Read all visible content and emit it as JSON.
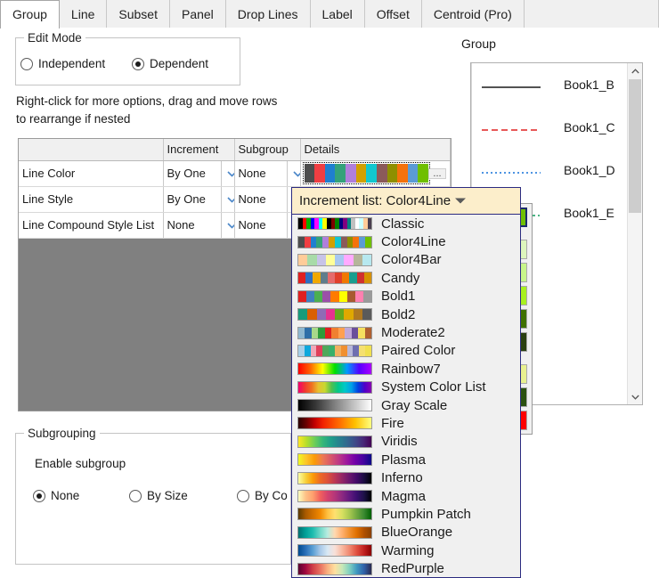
{
  "tabs": [
    {
      "label": "Group",
      "active": true
    },
    {
      "label": "Line",
      "active": false
    },
    {
      "label": "Subset",
      "active": false
    },
    {
      "label": "Panel",
      "active": false
    },
    {
      "label": "Drop Lines",
      "active": false
    },
    {
      "label": "Label",
      "active": false
    },
    {
      "label": "Offset",
      "active": false
    },
    {
      "label": "Centroid (Pro)",
      "active": false
    }
  ],
  "edit_mode": {
    "title": "Edit Mode",
    "options": [
      {
        "label": "Independent",
        "checked": false
      },
      {
        "label": "Dependent",
        "checked": true
      }
    ]
  },
  "hint": "Right-click for more options, drag and move rows to  rearrange if nested",
  "grid": {
    "headers": [
      "",
      "Increment",
      "Subgroup",
      "Details"
    ],
    "rows": [
      {
        "name": "Line Color",
        "increment": "By One",
        "subgroup": "None",
        "details_type": "palette"
      },
      {
        "name": "Line Style",
        "increment": "By One",
        "subgroup": "None",
        "details_type": "empty"
      },
      {
        "name": "Line Compound Style List",
        "increment": "None",
        "subgroup": "None",
        "details_type": "empty"
      }
    ],
    "details_palette": [
      "#4d4d4d",
      "#ef3e42",
      "#1f7fd0",
      "#34a27a",
      "#b07fdb",
      "#d2a000",
      "#12c7cf",
      "#8b5a5a",
      "#8f8f00",
      "#f5720c",
      "#5b9bd5",
      "#6fbf00"
    ],
    "ellipsis_label": "...",
    "empty_area_color": "#808080"
  },
  "group_panel": {
    "label": "Group",
    "items": [
      {
        "label": "Book1_B",
        "color": "#1a1a1a",
        "style": "solid"
      },
      {
        "label": "Book1_C",
        "color": "#e02020",
        "style": "dashed"
      },
      {
        "label": "Book1_D",
        "color": "#1470d8",
        "style": "dotted"
      },
      {
        "label": "Book1_E",
        "color": "#0f9a5a",
        "style": "dashdot"
      }
    ]
  },
  "subgrouping": {
    "title": "Subgrouping",
    "enable_label": "Enable subgroup",
    "options": [
      {
        "label": "None",
        "checked": true
      },
      {
        "label": "By Size",
        "checked": false
      },
      {
        "label": "By Co",
        "checked": false
      }
    ]
  },
  "increment_dropdown": {
    "header_label": "Increment list: Color4Line",
    "selected": "Color4Line",
    "items": [
      {
        "label": "Classic",
        "colors": [
          "#000000",
          "#ff0000",
          "#00b000",
          "#0000ff",
          "#ff00ff",
          "#00ffff",
          "#ffff00",
          "#000000",
          "#800000",
          "#008000",
          "#000080",
          "#800080",
          "#008080",
          "#c0c0c0",
          "#ffffff",
          "#ccffff",
          "#ffcc99",
          "#4a3f50"
        ]
      },
      {
        "label": "Color4Line",
        "colors": [
          "#4d4d4d",
          "#ef3e42",
          "#1f7fd0",
          "#34a27a",
          "#b07fdb",
          "#d2a000",
          "#12c7cf",
          "#8b5a5a",
          "#8f8f00",
          "#f5720c",
          "#5b9bd5",
          "#6fbf00"
        ]
      },
      {
        "label": "Color4Bar",
        "colors": [
          "#ffcc99",
          "#a8dba8",
          "#c7c3e8",
          "#ffff99",
          "#a8c8f0",
          "#ffaaff",
          "#b5b59a",
          "#b7e8ef"
        ]
      },
      {
        "label": "Candy",
        "colors": [
          "#e02020",
          "#2d6fc2",
          "#f0a800",
          "#5f7d8c",
          "#e56b6b",
          "#e0402a",
          "#f07800",
          "#1a9e8f",
          "#d03030",
          "#d59000"
        ]
      },
      {
        "label": "Bold1",
        "colors": [
          "#e02020",
          "#3f7fbf",
          "#4caf50",
          "#9b4fa8",
          "#ff7b00",
          "#ffff00",
          "#a85a30",
          "#ff80b0",
          "#9a9a9a"
        ]
      },
      {
        "label": "Bold2",
        "colors": [
          "#179b7a",
          "#d95f02",
          "#8f6bb5",
          "#e6318f",
          "#66a81e",
          "#e0a800",
          "#b07820",
          "#5a5a5a"
        ]
      },
      {
        "label": "Moderate2",
        "colors": [
          "#8fb8d0",
          "#2e6fa8",
          "#a8d98a",
          "#2e9b3a",
          "#e02020",
          "#f08030",
          "#ffa050",
          "#c0a8d8",
          "#6a4f9b",
          "#f5e060",
          "#b06030"
        ]
      },
      {
        "label": "Paired Color",
        "colors": [
          "#a8d0e8",
          "#0fa8dc",
          "#f0a8b8",
          "#e0405a",
          "#4fa85a",
          "#39b06a",
          "#f0b060",
          "#f09030",
          "#b8b8d8",
          "#6f6fb0",
          "#f5e070",
          "#f0e050"
        ]
      },
      {
        "label": "Rainbow7",
        "colors": [
          "#ff0000",
          "#ff6600",
          "#ffff00",
          "#00e000",
          "#0099ff",
          "#5500ff",
          "#aa00ff"
        ]
      },
      {
        "label": "System Color List",
        "colors": [
          "#f5006e",
          "#f03a30",
          "#f07020",
          "#e8c030",
          "#c8d830",
          "#4fc04f",
          "#00c888",
          "#00c8c8",
          "#00a0e8",
          "#0040e0",
          "#5000c8",
          "#8800b0"
        ]
      },
      {
        "label": "Gray Scale",
        "colors": [
          "#000000",
          "#3a3a3a",
          "#808080",
          "#c0c0c0",
          "#ffffff"
        ]
      },
      {
        "label": "Fire",
        "colors": [
          "#2a0000",
          "#6b0000",
          "#c00000",
          "#f02000",
          "#f84500",
          "#ff6a00",
          "#ff9500",
          "#ffc000",
          "#ffe040",
          "#ffff80"
        ]
      },
      {
        "label": "Viridis",
        "colors": [
          "#fde725",
          "#b5de2b",
          "#6ece58",
          "#35b779",
          "#1f9e89",
          "#26828e",
          "#31688e",
          "#3e4a89",
          "#482878",
          "#440154"
        ]
      },
      {
        "label": "Plasma",
        "colors": [
          "#f0f921",
          "#fdc328",
          "#fb9b06",
          "#ed7953",
          "#d8576b",
          "#bd3786",
          "#9c179e",
          "#7201a8",
          "#46039f",
          "#0d0887"
        ]
      },
      {
        "label": "Inferno",
        "colors": [
          "#fcffa4",
          "#f7d13d",
          "#fb9b06",
          "#ed6925",
          "#dd513a",
          "#bc3754",
          "#932667",
          "#6a176e",
          "#420a68",
          "#1b0c41",
          "#000004"
        ]
      },
      {
        "label": "Magma",
        "colors": [
          "#fcfdbf",
          "#fec287",
          "#fe9f6d",
          "#f1605d",
          "#d3436e",
          "#b5367a",
          "#8c2981",
          "#641a80",
          "#3b0f70",
          "#1d1147",
          "#000004"
        ]
      },
      {
        "label": "Pumpkin Patch",
        "colors": [
          "#5a3a00",
          "#a85a00",
          "#d07000",
          "#f08800",
          "#ffc040",
          "#ffe070",
          "#d8e060",
          "#a8c850",
          "#70a840",
          "#3a8a30",
          "#006000"
        ]
      },
      {
        "label": "BlueOrange",
        "colors": [
          "#007070",
          "#00a098",
          "#20bdb0",
          "#70d8c8",
          "#b8ece0",
          "#ffd8b0",
          "#ffb070",
          "#f09030",
          "#e07000",
          "#b05000",
          "#8a4000"
        ]
      },
      {
        "label": "Warming",
        "colors": [
          "#004a8f",
          "#2a6fb8",
          "#5a9fd4",
          "#a8c8e8",
          "#d8e8f4",
          "#f8e0d8",
          "#f8b8a0",
          "#f08870",
          "#e05040",
          "#c02020",
          "#8a0000"
        ]
      },
      {
        "label": "RedPurple",
        "colors": [
          "#5a0030",
          "#a00840",
          "#d04048",
          "#e87060",
          "#f8b080",
          "#ffe0a0",
          "#c8e8b8",
          "#80d0c0",
          "#4098c0",
          "#3060a8",
          "#2a2a50"
        ]
      }
    ]
  },
  "background_palette": {
    "rows": [
      {
        "type": "single",
        "selected": true,
        "colors": [
          "#8f8f00",
          "#f5720c",
          "#5b9bd5",
          "#6fbf00"
        ]
      },
      {
        "type": "spacer"
      },
      {
        "type": "single",
        "colors": [
          "#f5f0a0",
          "#ffd5b8",
          "#cfe0ef",
          "#ddf5bd"
        ]
      },
      {
        "type": "single",
        "colors": [
          "#f5e840",
          "#ffb488",
          "#a8c8e0",
          "#c8f58a"
        ]
      },
      {
        "type": "single",
        "colors": [
          "#fff000",
          "#f58c44",
          "#8fb4d8",
          "#a8f020"
        ]
      },
      {
        "type": "single",
        "colors": [
          "#5a7000",
          "#b04000",
          "#2e6aa8",
          "#3f7000"
        ]
      },
      {
        "type": "single",
        "colors": [
          "#3a4000",
          "#602000",
          "#1e3a58",
          "#2a4010"
        ]
      },
      {
        "type": "spacer"
      },
      {
        "type": "double",
        "left": [
          "#2020e0",
          "#8080c0",
          "#e8e850"
        ],
        "right": [
          "#2070a8",
          "#20c040",
          "#e8f090"
        ]
      },
      {
        "type": "double",
        "left": [
          "#6a8030",
          "#e8d040",
          "#ff2020"
        ],
        "right": [
          "#f08000",
          "#ffe8a0",
          "#2a5010"
        ]
      },
      {
        "type": "double",
        "left": [
          "#8000ff",
          "#00e0ff",
          "#40ff40",
          "#ffc000",
          "#ff0000"
        ],
        "right": [
          "#0000a0",
          "#3030ff",
          "#c0e020",
          "#ff8000",
          "#ff0000"
        ]
      }
    ]
  },
  "scrollbars": {
    "up_arrow": "chevron-up",
    "down_arrow": "chevron-down"
  }
}
